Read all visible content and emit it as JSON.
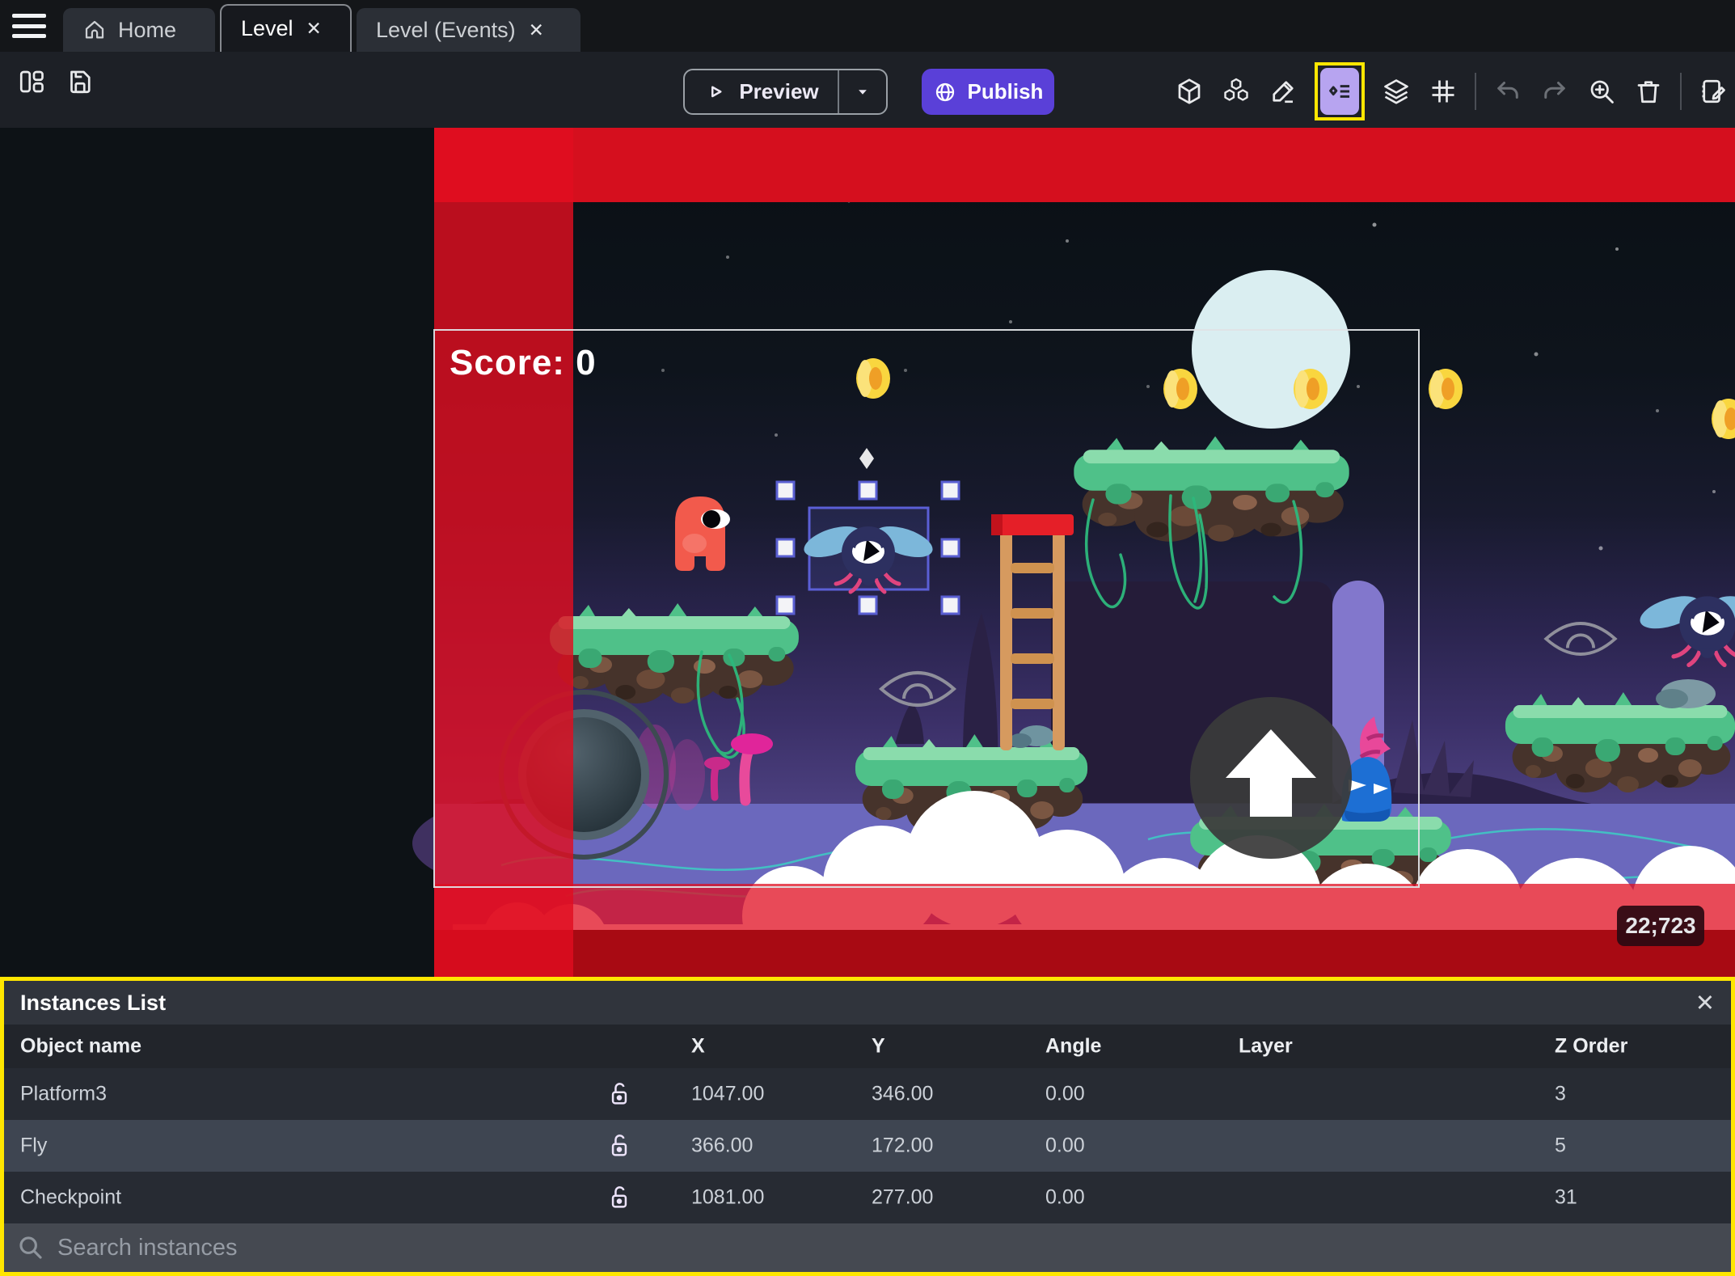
{
  "window": {
    "close_glyph": "✕",
    "tabs": [
      {
        "label": "Home",
        "icon": "home-icon",
        "closable": false
      },
      {
        "label": "Level",
        "active": true,
        "closable": true
      },
      {
        "label": "Level (Events)",
        "closable": true
      }
    ]
  },
  "toolbar": {
    "preview_label": "Preview",
    "publish_label": "Publish",
    "left_icons": [
      "layout-columns-icon",
      "save-icon"
    ],
    "right_icons": [
      "cube-3d-icon",
      "objects-group-icon",
      "draw-edit-icon",
      "instances-list-icon",
      "layers-icon",
      "grid-icon",
      "undo-icon",
      "redo-icon",
      "zoom-in-icon",
      "trash-icon",
      "edit-scene-properties-icon"
    ],
    "active_icon": "instances-list-icon",
    "accent_color": "#5a40d8",
    "highlight_color": "#ffe600"
  },
  "scene": {
    "score_label": "Score: 0",
    "camera_coords": "22;723",
    "selected_instance": "Fly",
    "overlay_color": "#d50f1e"
  },
  "instances_panel": {
    "title": "Instances List",
    "columns": [
      "Object name",
      "X",
      "Y",
      "Angle",
      "Layer",
      "Z Order"
    ],
    "rows": [
      {
        "name": "Platform3",
        "x": "1047.00",
        "y": "346.00",
        "angle": "0.00",
        "layer": "",
        "z_order": "3"
      },
      {
        "name": "Fly",
        "x": "366.00",
        "y": "172.00",
        "angle": "0.00",
        "layer": "",
        "z_order": "5"
      },
      {
        "name": "Checkpoint",
        "x": "1081.00",
        "y": "277.00",
        "angle": "0.00",
        "layer": "",
        "z_order": "31"
      }
    ],
    "selected_row": "Fly",
    "search_placeholder": "Search instances"
  }
}
